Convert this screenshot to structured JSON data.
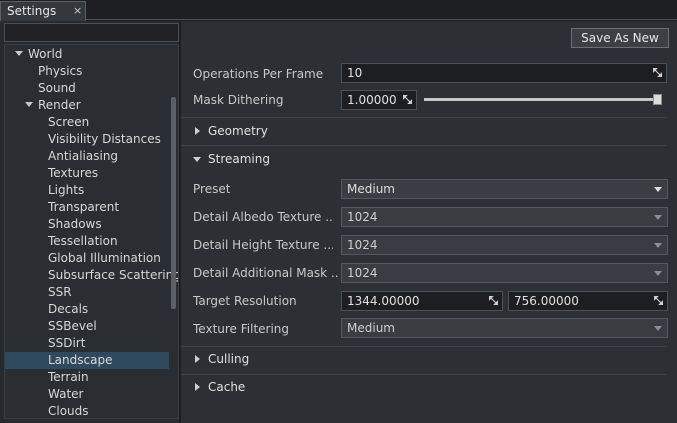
{
  "window": {
    "tab_title": "Settings",
    "tab_close": "×"
  },
  "tree": {
    "search_placeholder": "",
    "items": [
      {
        "label": "World",
        "expanded": true
      },
      {
        "label": "Physics"
      },
      {
        "label": "Sound"
      },
      {
        "label": "Render",
        "expanded": true
      },
      {
        "label": "Screen"
      },
      {
        "label": "Visibility Distances"
      },
      {
        "label": "Antialiasing"
      },
      {
        "label": "Textures"
      },
      {
        "label": "Lights"
      },
      {
        "label": "Transparent"
      },
      {
        "label": "Shadows"
      },
      {
        "label": "Tessellation"
      },
      {
        "label": "Global Illumination"
      },
      {
        "label": "Subsurface Scattering"
      },
      {
        "label": "SSR"
      },
      {
        "label": "Decals"
      },
      {
        "label": "SSBevel"
      },
      {
        "label": "SSDirt"
      },
      {
        "label": "Landscape",
        "selected": true
      },
      {
        "label": "Terrain"
      },
      {
        "label": "Water"
      },
      {
        "label": "Clouds"
      }
    ]
  },
  "toolbar": {
    "save_label": "Save As New"
  },
  "props": {
    "ops_label": "Operations Per Frame",
    "ops_value": "10",
    "dither_label": "Mask Dithering",
    "dither_value": "1.00000",
    "dither_slider": 1.0
  },
  "sections": {
    "geometry": "Geometry",
    "streaming": "Streaming",
    "culling": "Culling",
    "cache": "Cache"
  },
  "streaming": {
    "preset_label": "Preset",
    "preset_value": "Medium",
    "albedo_label": "Detail Albedo Texture ...",
    "albedo_value": "1024",
    "height_label": "Detail Height Texture ...",
    "height_value": "1024",
    "mask_label": "Detail Additional Mask ...",
    "mask_value": "1024",
    "target_label": "Target Resolution",
    "target_w": "1344.00000",
    "target_h": "756.00000",
    "filter_label": "Texture Filtering",
    "filter_value": "Medium"
  },
  "colors": {
    "accent_selected": "#2f4a5e",
    "background": "#2c2f33"
  }
}
